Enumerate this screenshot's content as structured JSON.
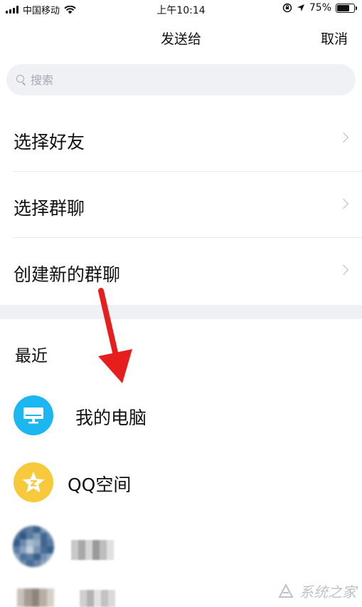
{
  "status_bar": {
    "carrier": "中国移动",
    "time": "上午10:14",
    "battery_percent": "75%",
    "battery_level": 0.75
  },
  "nav": {
    "title": "发送给",
    "cancel_label": "取消"
  },
  "search": {
    "placeholder": "搜索"
  },
  "menu": {
    "items": [
      {
        "label": "选择好友"
      },
      {
        "label": "选择群聊"
      },
      {
        "label": "创建新的群聊"
      }
    ]
  },
  "recent": {
    "title": "最近",
    "items": [
      {
        "name": "我的电脑",
        "icon": "computer-icon"
      },
      {
        "name": "QQ空间",
        "icon": "qzone-star-icon"
      }
    ]
  },
  "watermark": {
    "text": "系统之家"
  },
  "colors": {
    "pc_avatar": "#1cb7f0",
    "qzone_avatar": "#f7c93c",
    "arrow": "#e61e1e"
  }
}
